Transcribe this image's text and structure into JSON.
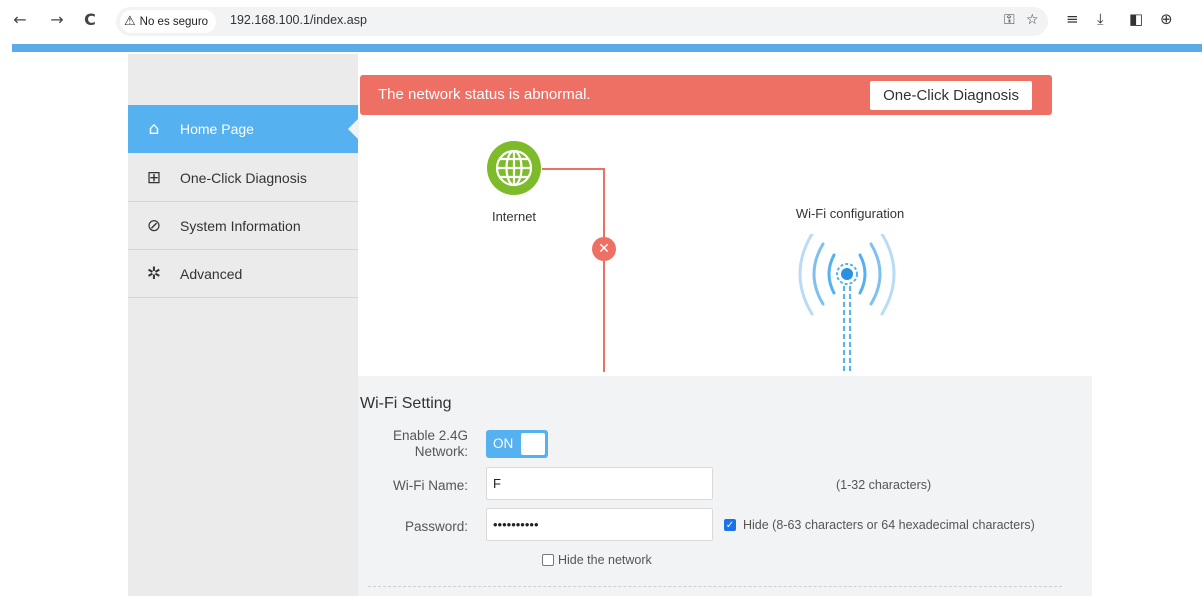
{
  "browser": {
    "back_icon": "←",
    "forward_icon": "→",
    "reload_icon": "C",
    "security_label": "No es seguro",
    "url": "192.168.100.1/index.asp"
  },
  "sidebar": {
    "items": [
      {
        "label": "Home Page",
        "icon": "home-icon",
        "active": true
      },
      {
        "label": "One-Click Diagnosis",
        "icon": "first-aid-icon"
      },
      {
        "label": "System Information",
        "icon": "pulse-icon"
      },
      {
        "label": "Advanced",
        "icon": "gear-icon"
      }
    ]
  },
  "status": {
    "message": "The network status is abnormal.",
    "button_label": "One-Click Diagnosis"
  },
  "diagram": {
    "internet_label": "Internet",
    "wifi_label": "Wi-Fi configuration"
  },
  "wifi_setting": {
    "title": "Wi-Fi Setting",
    "enable_label_line1": "Enable 2.4G",
    "enable_label_line2": "Network:",
    "toggle_label": "ON",
    "name_label": "Wi-Fi Name:",
    "name_value": "F",
    "name_hint": "(1-32 characters)",
    "password_label": "Password:",
    "password_value": "••••••••••",
    "hide_password_label": "Hide (8-63 characters or 64 hexadecimal characters)",
    "hide_network_label": "Hide the network"
  },
  "colors": {
    "accent_blue": "#56b1f0",
    "alert_red": "#ee6f64",
    "globe_green": "#7dbb2a"
  }
}
